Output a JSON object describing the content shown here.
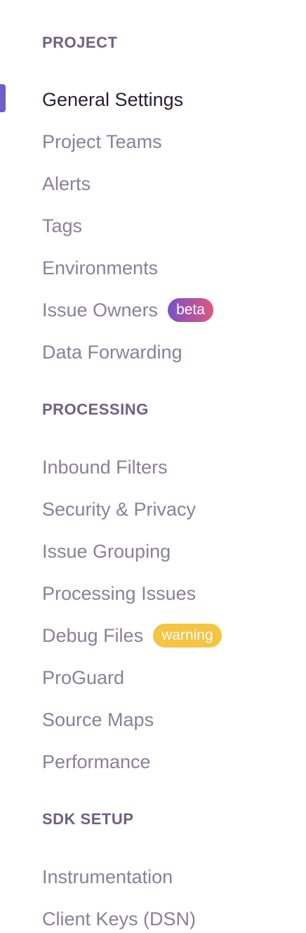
{
  "sections": [
    {
      "header": "PROJECT",
      "items": [
        {
          "label": "General Settings",
          "active": true
        },
        {
          "label": "Project Teams"
        },
        {
          "label": "Alerts"
        },
        {
          "label": "Tags"
        },
        {
          "label": "Environments"
        },
        {
          "label": "Issue Owners",
          "badge": "beta"
        },
        {
          "label": "Data Forwarding"
        }
      ]
    },
    {
      "header": "PROCESSING",
      "items": [
        {
          "label": "Inbound Filters"
        },
        {
          "label": "Security & Privacy"
        },
        {
          "label": "Issue Grouping"
        },
        {
          "label": "Processing Issues"
        },
        {
          "label": "Debug Files",
          "badge": "warning"
        },
        {
          "label": "ProGuard"
        },
        {
          "label": "Source Maps"
        },
        {
          "label": "Performance"
        }
      ]
    },
    {
      "header": "SDK SETUP",
      "items": [
        {
          "label": "Instrumentation"
        },
        {
          "label": "Client Keys (DSN)"
        }
      ]
    }
  ],
  "colors": {
    "active_indicator": "#6c5fc7",
    "header_text": "#6f5f86",
    "item_text": "#8b7f99",
    "active_text": "#2b1d38",
    "beta_badge_start": "#7653c7",
    "beta_badge_end": "#e1567c",
    "warning_badge": "#f5c443"
  }
}
